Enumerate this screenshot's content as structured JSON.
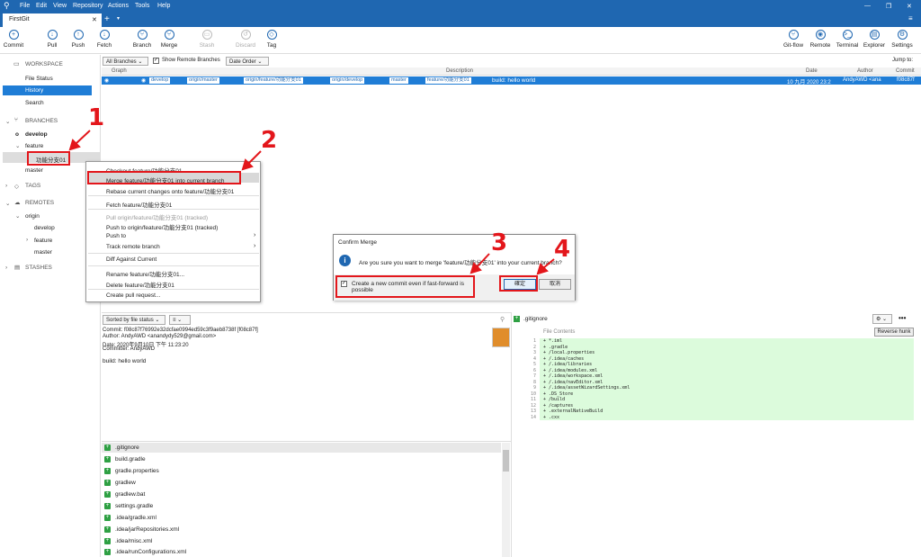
{
  "menubar": {
    "items": [
      "File",
      "Edit",
      "View",
      "Repository",
      "Actions",
      "Tools",
      "Help"
    ]
  },
  "tab": {
    "title": "FirstGit",
    "close": "✕",
    "add": "+"
  },
  "toolbar": {
    "left": [
      {
        "label": "Commit",
        "icon": "+"
      },
      {
        "label": "Pull",
        "icon": "↓"
      },
      {
        "label": "Push",
        "icon": "↑"
      },
      {
        "label": "Fetch",
        "icon": "↓"
      },
      {
        "label": "Branch",
        "icon": "⑂"
      },
      {
        "label": "Merge",
        "icon": "⑂"
      },
      {
        "label": "Stash",
        "icon": "▭"
      },
      {
        "label": "Discard",
        "icon": "↺"
      },
      {
        "label": "Tag",
        "icon": "◇"
      }
    ],
    "right": [
      {
        "label": "Git-flow",
        "icon": "⑂"
      },
      {
        "label": "Remote",
        "icon": "◉"
      },
      {
        "label": "Terminal",
        "icon": ">_"
      },
      {
        "label": "Explorer",
        "icon": "▤"
      },
      {
        "label": "Settings",
        "icon": "⚙"
      }
    ]
  },
  "sidebar": {
    "workspace": "WORKSPACE",
    "file_status": "File Status",
    "history": "History",
    "search": "Search",
    "branches": "BRANCHES",
    "develop": "develop",
    "feature": "feature",
    "feature_branch": "功能分支01",
    "master": "master",
    "tags": "TAGS",
    "remotes": "REMOTES",
    "origin": "origin",
    "r_develop": "develop",
    "r_feature": "feature",
    "r_master": "master",
    "stashes": "STASHES"
  },
  "filter": {
    "branches": "All Branches",
    "show_remote": "Show Remote Branches",
    "order": "Date Order",
    "jump": "Jump to:"
  },
  "columns": {
    "graph": "Graph",
    "description": "Description",
    "date": "Date",
    "author": "Author",
    "commit": "Commit"
  },
  "commit_row": {
    "tags": [
      "develop",
      "origin/master",
      "origin/feature/功能分支01",
      "origin/develop",
      "master",
      "feature/功能分支01"
    ],
    "message": "build: hello world",
    "date": "10 九月 2020 23:2",
    "author": "AndyAWD <ana",
    "hash": "f08c87f"
  },
  "context_menu": {
    "checkout": "Checkout feature/功能分支01...",
    "merge": "Merge feature/功能分支01 into current branch",
    "rebase": "Rebase current changes onto feature/功能分支01",
    "fetch": "Fetch feature/功能分支01",
    "pull": "Pull origin/feature/功能分支01 (tracked)",
    "push_to": "Push to origin/feature/功能分支01 (tracked)",
    "push": "Push to",
    "track": "Track remote branch",
    "diff": "Diff Against Current",
    "rename": "Rename feature/功能分支01...",
    "delete": "Delete feature/功能分支01",
    "pr": "Create pull request..."
  },
  "dialog": {
    "title": "Confirm Merge",
    "message": "Are you sure you want to merge 'feature/功能分支01' into your current branch?",
    "checkbox": "Create a new commit even if fast-forward is possible",
    "ok": "確定",
    "cancel": "取消"
  },
  "annotations": [
    "1",
    "2",
    "3",
    "4"
  ],
  "details": {
    "sort": "Sorted by file status",
    "commit": "Commit: f08c87f76992e32dcfae0994ed59c3f9aeb8738f [f08c87f]",
    "author": "Author: AndyAWD <anandydy529@gmail.com>",
    "date": "Date: 2020年9月10日 下午 11:23:20",
    "committer": "Committer: AndyAWD",
    "message": "build: hello world"
  },
  "files": [
    ".gitignore",
    "build.gradle",
    "gradle.properties",
    "gradlew",
    "gradlew.bat",
    "settings.gradle",
    ".idea/gradle.xml",
    ".idea/jarRepositories.xml",
    ".idea/misc.xml",
    ".idea/runConfigurations.xml"
  ],
  "diff": {
    "file": ".gitignore",
    "header": "File Contents",
    "reverse": "Reverse hunk",
    "lines": [
      "+ *.iml",
      "+ .gradle",
      "+ /local.properties",
      "+ /.idea/caches",
      "+ /.idea/libraries",
      "+ /.idea/modules.xml",
      "+ /.idea/workspace.xml",
      "+ /.idea/navEditor.xml",
      "+ /.idea/assetWizardSettings.xml",
      "+ .DS_Store",
      "+ /build",
      "+ /captures",
      "+ .externalNativeBuild",
      "+ .cxx"
    ]
  },
  "colors": {
    "accent": "#1f67b1",
    "selection": "#1f7dd6",
    "annotation": "#e3161b",
    "added": "#dcfbdc"
  }
}
